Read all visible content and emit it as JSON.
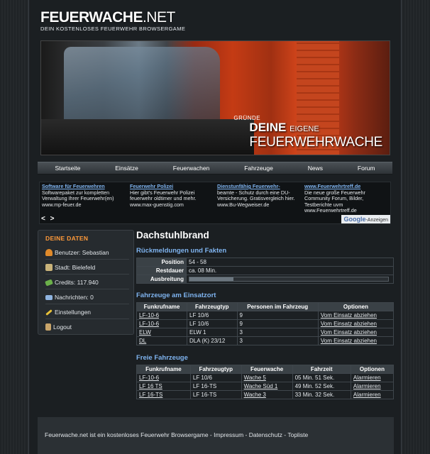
{
  "header": {
    "logo_main": "FEUERWACHE",
    "logo_dot_net": ".NET",
    "logo_sub": "DEIN KOSTENLOSES FEUERWEHR BROWSERGAME"
  },
  "banner": {
    "small": "GRÜNDE",
    "line1_big": "DEINE",
    "line1_small": "EIGENE",
    "line2": "FEUERWEHRWACHE"
  },
  "nav": {
    "items": [
      "Startseite",
      "Einsätze",
      "Feuerwachen",
      "Fahrzeuge",
      "News",
      "Forum"
    ]
  },
  "ads": {
    "items": [
      {
        "title": "Software für Feuerwehren",
        "text": "Softwarepaket zur kompletten Verwaltung Ihrer Feuerwehr(en)",
        "url": "www.mp-feuer.de"
      },
      {
        "title": "Feuerwehr Polizei",
        "text": "Hier gibt's Feuerwehr Polizei feuerwehr oldtimer und mehr.",
        "url": "www.max-guenstig.com"
      },
      {
        "title": "Dienstunfähig Feuerwehr-",
        "text": "beamte - Schutz durch eine DU-Versicherung. Gratisvergleich hier.",
        "url": "www.Bu-Wegweiser.de"
      },
      {
        "title": "www.Feuerwehrtreff.de",
        "text": "Die neue große Feuerwehr Community Forum, Bilder, Testberichte uvm",
        "url": "www.Feuerwehrtreff.de"
      }
    ],
    "arrows": "< >",
    "google_brand": "Google",
    "google_label": "-Anzeigen"
  },
  "sidebar": {
    "heading": "DEINE DATEN",
    "items": [
      {
        "label": "Benutzer: Sebastian",
        "icon": "user-icon",
        "color": "#e08a2a"
      },
      {
        "label": "Stadt: Bielefeld",
        "icon": "city-icon",
        "color": "#c9b37a"
      },
      {
        "label": "Credits: 117.940",
        "icon": "money-icon",
        "color": "#6bb04a"
      },
      {
        "label": "Nachrichten: 0",
        "icon": "mail-icon",
        "color": "#8fb4e0"
      },
      {
        "label": "Einstellungen",
        "icon": "pencil-icon",
        "color": "#e8c23a"
      },
      {
        "label": "Logout",
        "icon": "logout-icon",
        "color": "#c9a56a"
      }
    ]
  },
  "main": {
    "title": "Dachstuhlbrand",
    "facts": {
      "heading": "Rückmeldungen und Fakten",
      "position_label": "Position",
      "position_value": "54 - 58",
      "restdauer_label": "Restdauer",
      "restdauer_value": "ca. 08 Min.",
      "ausbreitung_label": "Ausbreitung",
      "ausbreitung_level": 0.22
    },
    "vehicles_at_scene": {
      "heading": "Fahrzeuge am Einsatzort",
      "columns": [
        "Funkrufname",
        "Fahrzeugtyp",
        "Personen im Fahrzeug",
        "Optionen"
      ],
      "rows": [
        {
          "name": "LF-10-6",
          "type": "LF 10/6",
          "persons": "9",
          "option": "Vom Einsatz abziehen"
        },
        {
          "name": "LF-10-6",
          "type": "LF 10/6",
          "persons": "9",
          "option": "Vom Einsatz abziehen"
        },
        {
          "name": "ELW",
          "type": "ELW 1",
          "persons": "3",
          "option": "Vom Einsatz abziehen"
        },
        {
          "name": "DL",
          "type": "DLA (K) 23/12",
          "persons": "3",
          "option": "Vom Einsatz abziehen"
        }
      ]
    },
    "free_vehicles": {
      "heading": "Freie Fahrzeuge",
      "columns": [
        "Funkrufname",
        "Fahrzeugtyp",
        "Feuerwache",
        "Fahrzeit",
        "Optionen"
      ],
      "rows": [
        {
          "name": "LF-10-6",
          "type": "LF 10/6",
          "station": "Wache 5",
          "time": "05 Min. 51 Sek.",
          "option": "Alarmieren"
        },
        {
          "name": "LF 16 TS",
          "type": "LF 16-TS",
          "station": "Wache Süd 1",
          "time": "49 Min. 52 Sek.",
          "option": "Alarmieren"
        },
        {
          "name": "LF 16-TS",
          "type": "LF 16-TS",
          "station": "Wache 3",
          "time": "33 Min. 32 Sek.",
          "option": "Alarmieren"
        }
      ]
    }
  },
  "footer": {
    "text": "Feuerwache.net ist ein kostenloses Feuerwehr Browsergame - Impressum - Datenschutz - Topliste"
  }
}
